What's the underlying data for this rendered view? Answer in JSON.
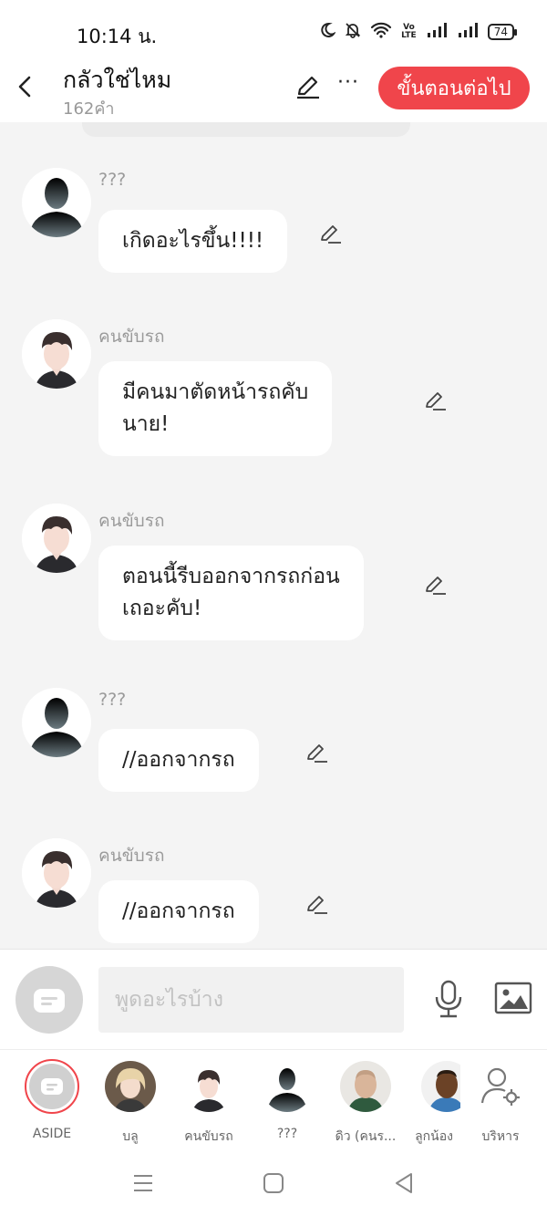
{
  "status_bar": {
    "time": "10:14 น.",
    "volte_top": "Vo",
    "volte_bottom": "LTE",
    "battery": "74"
  },
  "header": {
    "title": "กลัวใช่ไหม",
    "word_count": "162คำ",
    "more_label": "···",
    "next_button": "ขั้นตอนต่อไป"
  },
  "messages": [
    {
      "speaker": "???",
      "avatar": "silhouette-avatar",
      "text": "เกิดอะไรขึ้น!!!!"
    },
    {
      "speaker": "คนขับรถ",
      "avatar": "driver-avatar",
      "text": "มีคนมาตัดหน้ารถคับ\nนาย!"
    },
    {
      "speaker": "คนขับรถ",
      "avatar": "driver-avatar",
      "text": "ตอนนี้รีบออกจากรถก่อน\nเถอะคับ!"
    },
    {
      "speaker": "???",
      "avatar": "silhouette-avatar",
      "text": "//ออกจากรถ"
    },
    {
      "speaker": "คนขับรถ",
      "avatar": "driver-avatar",
      "text": "//ออกจากรถ"
    }
  ],
  "input": {
    "placeholder": "พูดอะไรบ้าง"
  },
  "characters": [
    {
      "label": "ASIDE"
    },
    {
      "label": "บลู"
    },
    {
      "label": "คนขับรถ"
    },
    {
      "label": "???"
    },
    {
      "label": "ดิว (คนร..."
    },
    {
      "label": "ลูกน้อง"
    },
    {
      "label": "บริหาร"
    }
  ],
  "colors": {
    "accent": "#f0454b",
    "background": "#f4f4f4",
    "bubble": "#ffffff"
  }
}
